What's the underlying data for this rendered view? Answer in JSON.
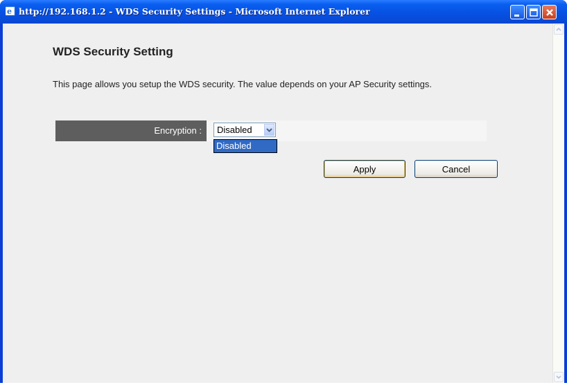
{
  "window": {
    "title": "http://192.168.1.2 - WDS Security Settings - Microsoft Internet Explorer"
  },
  "page": {
    "title": "WDS Security Setting",
    "description": "This page allows you setup the WDS security. The value depends on your AP Security settings."
  },
  "encryption": {
    "label": "Encryption :",
    "selected": "Disabled",
    "options": [
      "Disabled"
    ]
  },
  "buttons": {
    "apply": "Apply",
    "cancel": "Cancel"
  },
  "colors": {
    "titlebar": "#0a5ff0",
    "label_cell": "#5e5e5e",
    "selection": "#316ac5",
    "page_bg": "#efefef"
  }
}
